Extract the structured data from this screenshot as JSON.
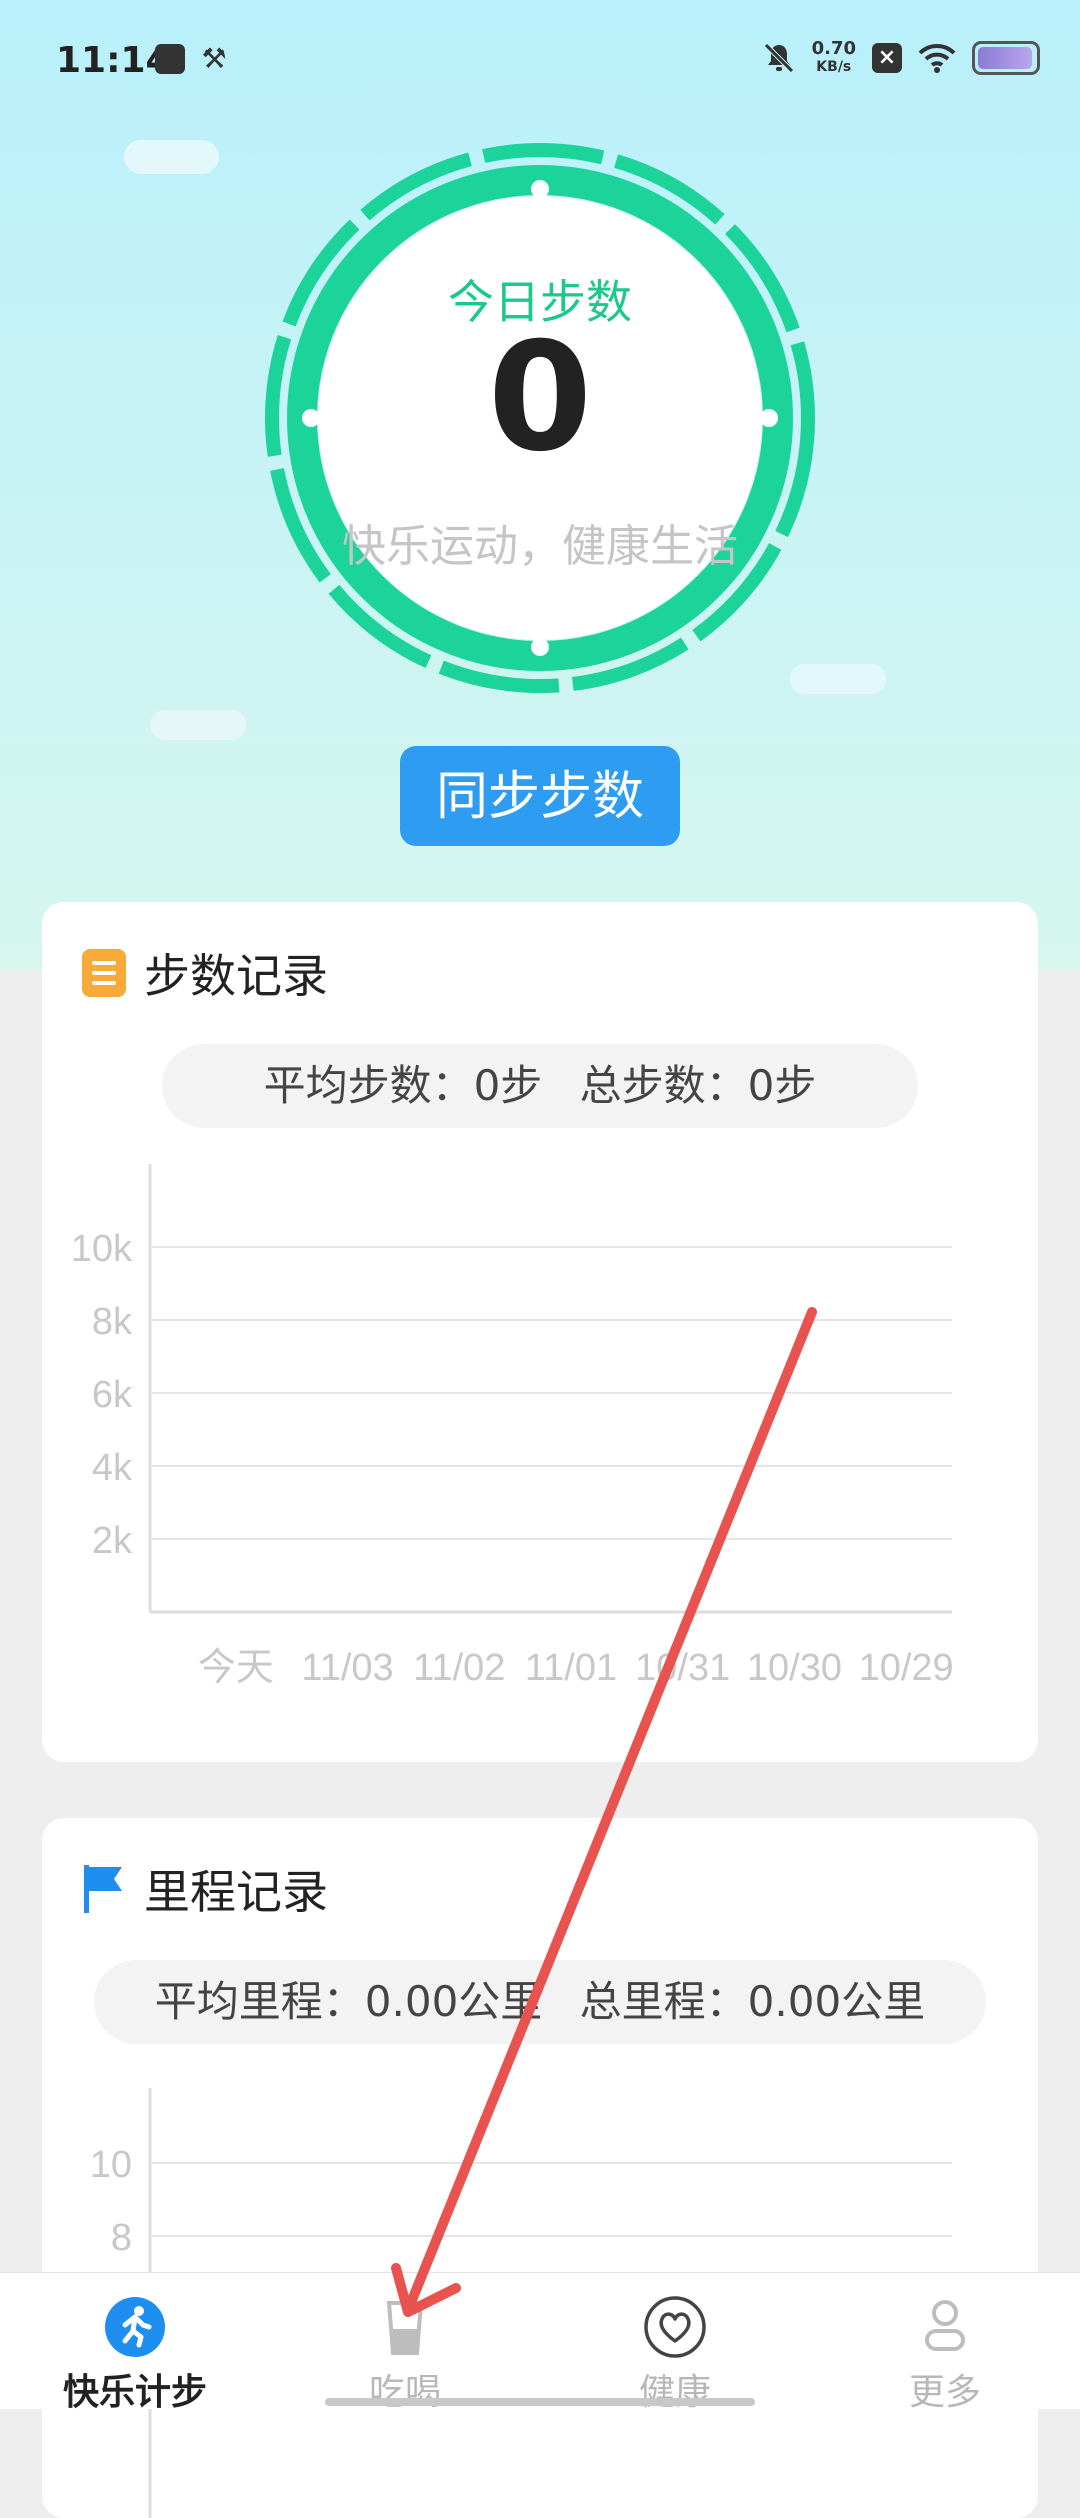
{
  "status_bar": {
    "time": "11:14",
    "net_speed": "0.70",
    "net_unit": "KB/s"
  },
  "hero": {
    "title": "今日步数",
    "steps": "0",
    "slogan": "快乐运动，健康生活",
    "sync_button": "同步步数"
  },
  "step_record": {
    "title": "步数记录",
    "avg_label": "平均步数：0步",
    "total_label": "总步数：0步",
    "chart_data": {
      "type": "bar",
      "categories": [
        "今天",
        "11/03",
        "11/02",
        "11/01",
        "10/31",
        "10/30",
        "10/29"
      ],
      "values": [
        0,
        0,
        0,
        0,
        0,
        0,
        0
      ],
      "y_ticks": [
        "2k",
        "4k",
        "6k",
        "8k",
        "10k"
      ],
      "ylim": [
        0,
        10000
      ],
      "grid": true
    }
  },
  "distance_record": {
    "title": "里程记录",
    "avg_label": "平均里程：0.00公里",
    "total_label": "总里程：0.00公里",
    "chart_data": {
      "type": "bar",
      "y_ticks": [
        "8",
        "10"
      ],
      "grid": true
    }
  },
  "bottom_nav": [
    {
      "label": "快乐计步",
      "icon": "running-icon",
      "active": true
    },
    {
      "label": "吃喝",
      "icon": "cup-icon",
      "active": false
    },
    {
      "label": "健康",
      "icon": "heart-icon",
      "active": false
    },
    {
      "label": "更多",
      "icon": "person-icon",
      "active": false
    }
  ],
  "colors": {
    "accent_green": "#1cc98a",
    "button_blue": "#2e9cf1",
    "annotation_arrow": "#e8534f"
  }
}
